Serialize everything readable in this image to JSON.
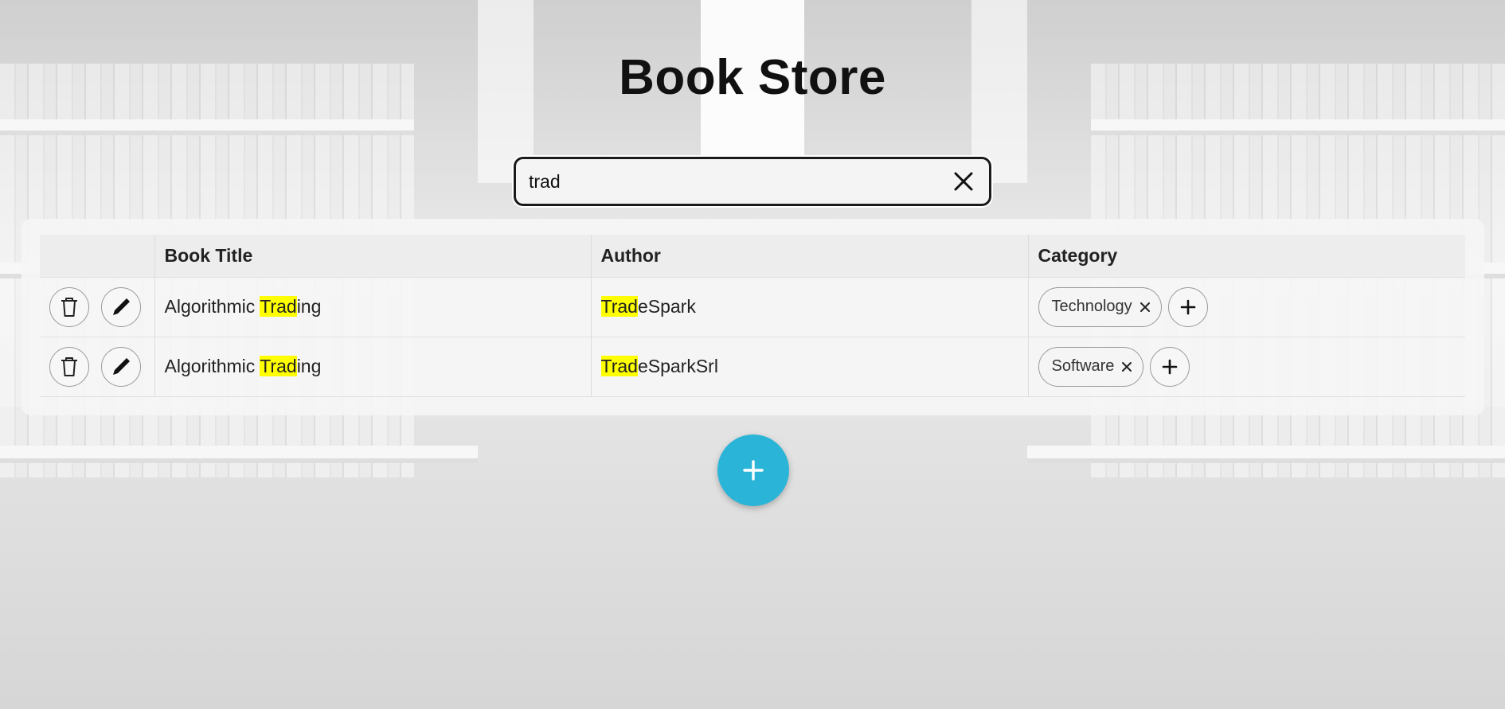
{
  "header": {
    "title": "Book Store"
  },
  "search": {
    "value": "trad",
    "placeholder": ""
  },
  "table": {
    "columns": [
      "",
      "Book Title",
      "Author",
      "Category"
    ],
    "rows": [
      {
        "title": {
          "before": "Algorithmic ",
          "match": "Trad",
          "after": "ing"
        },
        "author": {
          "before": "",
          "match": "Trad",
          "after": "eSpark"
        },
        "category": "Technology"
      },
      {
        "title": {
          "before": "Algorithmic ",
          "match": "Trad",
          "after": "ing"
        },
        "author": {
          "before": "",
          "match": "Trad",
          "after": "eSparkSrl"
        },
        "category": "Software"
      }
    ]
  },
  "colors": {
    "accent": "#2ab5d8",
    "highlight": "#ffff00"
  },
  "icons": {
    "delete": "trash-icon",
    "edit": "pencil-icon",
    "remove_category": "close-icon",
    "add_category": "plus-icon",
    "clear_search": "close-icon",
    "add_book": "plus-icon"
  }
}
